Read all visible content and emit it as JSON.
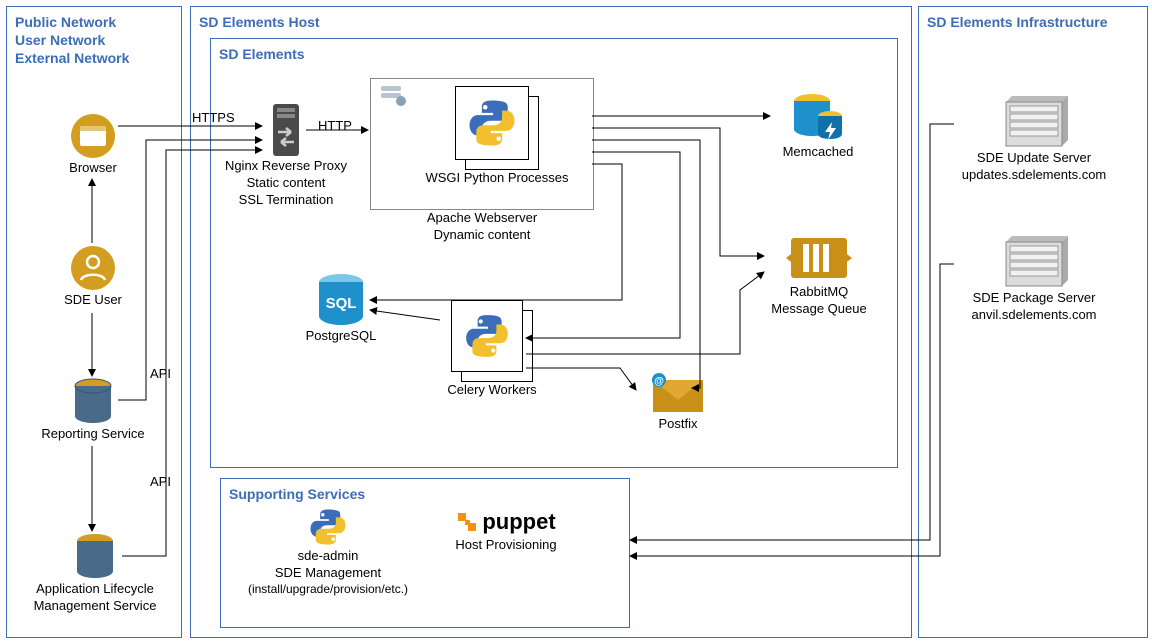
{
  "columns": {
    "left": {
      "title_lines": [
        "Public Network",
        "User Network",
        "External Network"
      ]
    },
    "mid": {
      "title": "SD Elements Host"
    },
    "right": {
      "title": "SD Elements Infrastructure"
    }
  },
  "inner_boxes": {
    "sd_elements": {
      "title": "SD Elements"
    },
    "supporting": {
      "title": "Supporting Services"
    }
  },
  "nodes": {
    "browser": {
      "label": "Browser"
    },
    "sde_user": {
      "label": "SDE User"
    },
    "reporting": {
      "label": "Reporting Service"
    },
    "alm": {
      "label_line1": "Application Lifecycle",
      "label_line2": "Management Service"
    },
    "nginx": {
      "line1": "Nginx Reverse Proxy",
      "line2": "Static content",
      "line3": "SSL Termination"
    },
    "apache": {
      "line1": "Apache Webserver",
      "line2": "Dynamic content"
    },
    "wsgi": {
      "label": "WSGI Python Processes"
    },
    "memcached": {
      "label": "Memcached"
    },
    "rabbitmq": {
      "line1": "RabbitMQ",
      "line2": "Message Queue"
    },
    "postgres": {
      "label": "PostgreSQL"
    },
    "celery": {
      "label": "Celery Workers"
    },
    "postfix": {
      "label": "Postfix"
    },
    "sde_admin": {
      "line1": "sde-admin",
      "line2": "SDE Management",
      "line3": "(install/upgrade/provision/etc.)"
    },
    "puppet": {
      "label": "Host Provisioning",
      "brand": "puppet"
    },
    "update_server": {
      "line1": "SDE Update Server",
      "line2": "updates.sdelements.com"
    },
    "package_server": {
      "line1": "SDE Package Server",
      "line2": "anvil.sdelements.com"
    }
  },
  "edge_labels": {
    "https": "HTTPS",
    "http": "HTTP",
    "api1": "API",
    "api2": "API"
  }
}
